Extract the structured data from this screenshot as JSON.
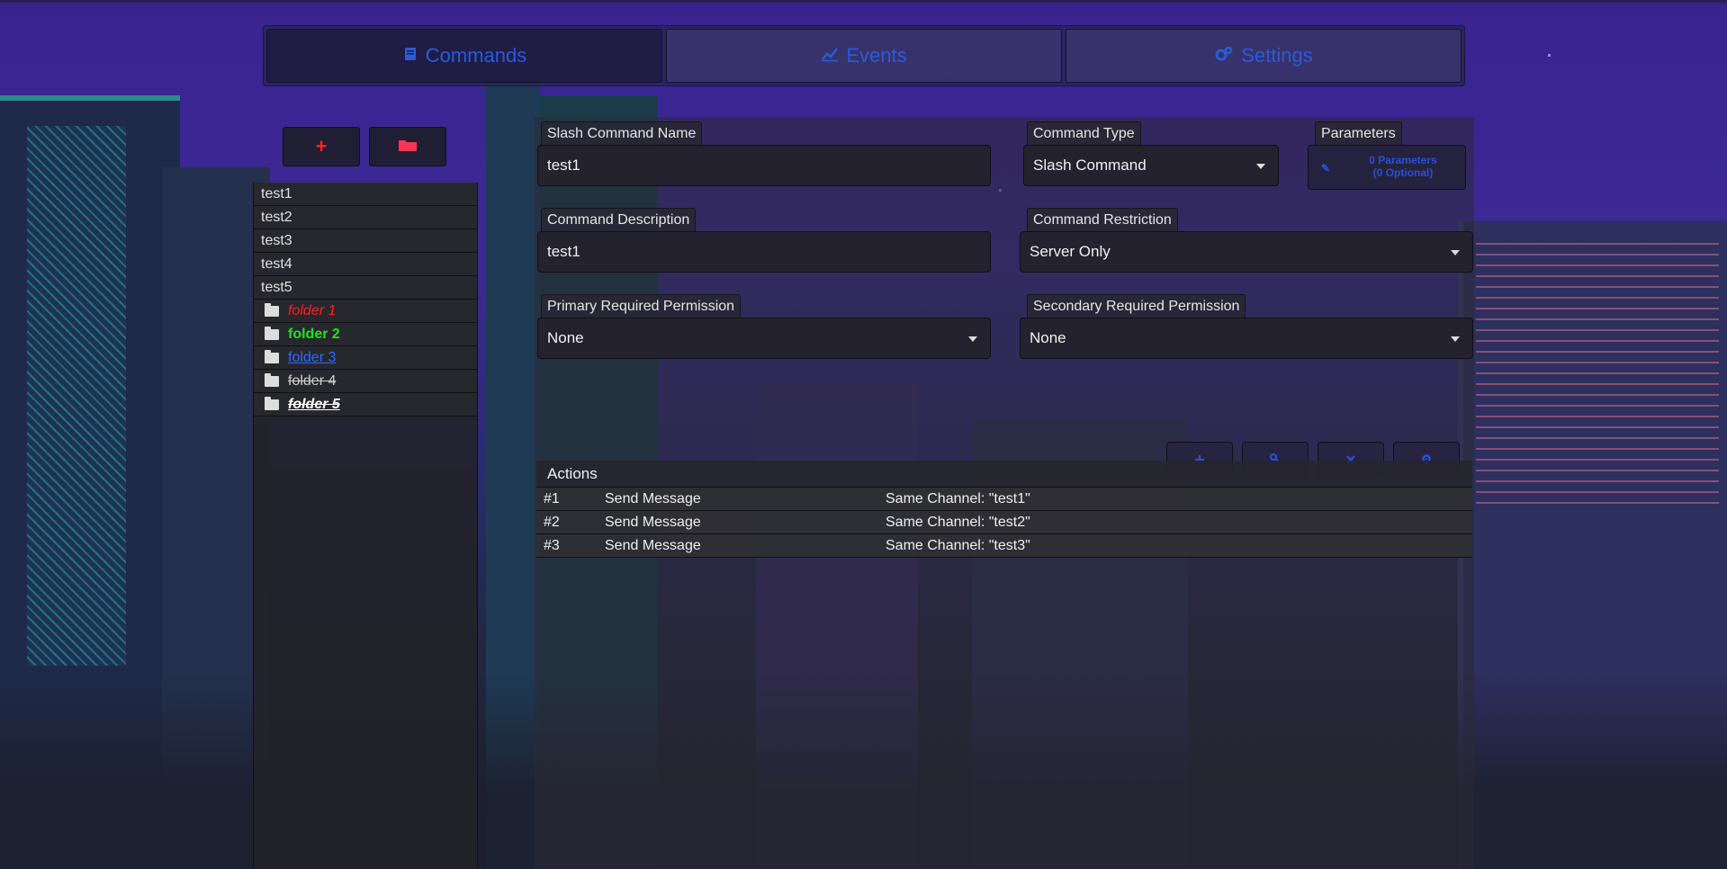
{
  "tabs": [
    {
      "label": "Commands",
      "icon": "book-icon",
      "active": true
    },
    {
      "label": "Events",
      "icon": "chart-line-icon",
      "active": false
    },
    {
      "label": "Settings",
      "icon": "cogs-icon",
      "active": false
    }
  ],
  "sidebar": {
    "add_label": "+",
    "commands": [
      "test1",
      "test2",
      "test3",
      "test4",
      "test5"
    ],
    "folders": [
      {
        "label": "folder 1",
        "color": "#ff1f1f"
      },
      {
        "label": "folder 2",
        "color": "#22e022"
      },
      {
        "label": "folder 3",
        "color": "#2b6bff"
      },
      {
        "label": "folder 4",
        "color": "#cfcfcf"
      },
      {
        "label": "folder 5",
        "color": "#ffffff"
      }
    ]
  },
  "form": {
    "name_label": "Slash Command Name",
    "name_value": "test1",
    "type_label": "Command Type",
    "type_value": "Slash Command",
    "params_label": "Parameters",
    "params_line1": "0 Parameters",
    "params_line2": "(0 Optional)",
    "desc_label": "Command Description",
    "desc_value": "test1",
    "restriction_label": "Command Restriction",
    "restriction_value": "Server Only",
    "primary_perm_label": "Primary Required Permission",
    "primary_perm_value": "None",
    "secondary_perm_label": "Secondary Required Permission",
    "secondary_perm_value": "None"
  },
  "actions": {
    "title": "Actions",
    "rows": [
      {
        "num": "#1",
        "action": "Send Message",
        "detail": "Same Channel: \"test1\""
      },
      {
        "num": "#2",
        "action": "Send Message",
        "detail": "Same Channel: \"test2\""
      },
      {
        "num": "#3",
        "action": "Send Message",
        "detail": "Same Channel: \"test3\""
      }
    ],
    "tool_icons": [
      "plus-icon",
      "wrench-icon",
      "close-icon",
      "gear-icon"
    ]
  },
  "colors": {
    "accent": "#2a5bd7",
    "add_button": "#ff2020"
  }
}
